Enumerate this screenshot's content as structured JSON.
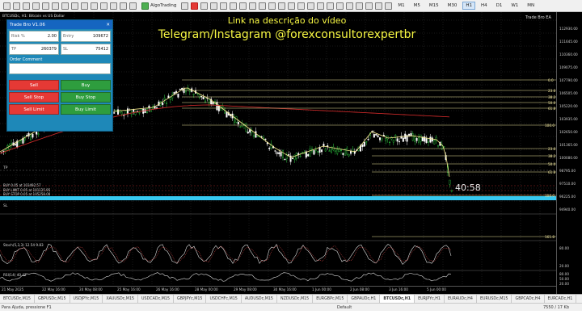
{
  "toolbar": {
    "algo_label": "AlgoTrading",
    "timeframes": [
      "M1",
      "M5",
      "M15",
      "M30",
      "H1",
      "H4",
      "D1",
      "W1",
      "MN"
    ],
    "active_timeframe": "H1"
  },
  "chart": {
    "symbol_label": "BTCUSDc, H1: Bitcoin vs US Dollar",
    "ea_label": "Trade Bro EA",
    "overlay_line1": "Link na descrição do vídeo",
    "overlay_line2": "Telegram/Instagram @forexconsultorexpertbr",
    "countdown": "40:58",
    "tp_label": "TP",
    "sl_label": "SL",
    "price_ticks": [
      "112930.00",
      "111645.00",
      "110360.00",
      "109075.00",
      "107790.00",
      "106505.00",
      "105220.00",
      "103935.00",
      "102650.00",
      "101365.00",
      "100080.00",
      "98795.00",
      "97510.00",
      "96225.00",
      "94940.00"
    ],
    "fib_levels": [
      "0.0",
      "23.6",
      "38.2",
      "50.0",
      "61.8",
      "100.0",
      "23.6",
      "38.2",
      "50.0",
      "61.8",
      "100.0",
      "161.8"
    ],
    "trade_lines": [
      "BUY 0.05 at 103492.57",
      "BUY LIMIT 0.05 at 101125.95",
      "BUY STOP 0.05 at 105258.00"
    ],
    "stoch_label": "Stoch(5,3,3) 12.54 9.83",
    "stoch_ticks": [
      "80.00",
      "20.00"
    ],
    "rsi_label": "RSI(14) 40.42",
    "rsi_ticks": [
      "80.00",
      "50.00",
      "20.00"
    ],
    "time_ticks": [
      "21 May 2025",
      "22 May 16:00",
      "24 May 08:00",
      "25 May 16:00",
      "26 May 16:00",
      "28 May 00:00",
      "29 May 08:00",
      "30 May 16:00",
      "1 Jun 00:00",
      "2 Jun 08:00",
      "3 Jun 16:00",
      "5 Jun 00:00"
    ]
  },
  "panel": {
    "title": "Trade Bro V1.06",
    "close_glyph": "✕",
    "risk_label": "Risk %",
    "risk_value": "2.00",
    "entry_label": "Entry",
    "entry_value": "109672",
    "tp_label": "TP",
    "tp_value": "260379",
    "sl_label": "SL",
    "sl_value": "75412",
    "order_comment_label": "Order Comment",
    "buttons": {
      "sell": "Sell",
      "buy": "Buy",
      "sell_stop": "Sell Stop",
      "buy_stop": "Buy Stop",
      "sell_limit": "Sell Limit",
      "buy_limit": "Buy Limit"
    }
  },
  "tabs": [
    "BTCUSDc,M15",
    "GBPUSDc,M15",
    "USDJPYc,M15",
    "XAUUSDc,M15",
    "USDCADc,M15",
    "GBPJPYc,M15",
    "USDCHFc,M15",
    "AUDUSDc,M15",
    "NZDUSDc,M15",
    "EURGBPc,M15",
    "GBPAUDc,H1",
    "BTCUSDc,H1",
    "EURJPYc,H1",
    "EURAUDc,H4",
    "EURUSDc,M15",
    "GBPCADc,H4",
    "EURCADc,H1"
  ],
  "active_tab": "BTCUSDc,H1",
  "status": {
    "help": "Para Ajuda, pressione F1",
    "profile": "Default",
    "traffic": "7550 / 17 Kb"
  },
  "colors": {
    "overlay_text": "#f5f542",
    "ma_fast": "#f2e68a",
    "ma_slow": "#c62828",
    "fib": "#e8df9a",
    "sl_band": "#37c8f0"
  }
}
